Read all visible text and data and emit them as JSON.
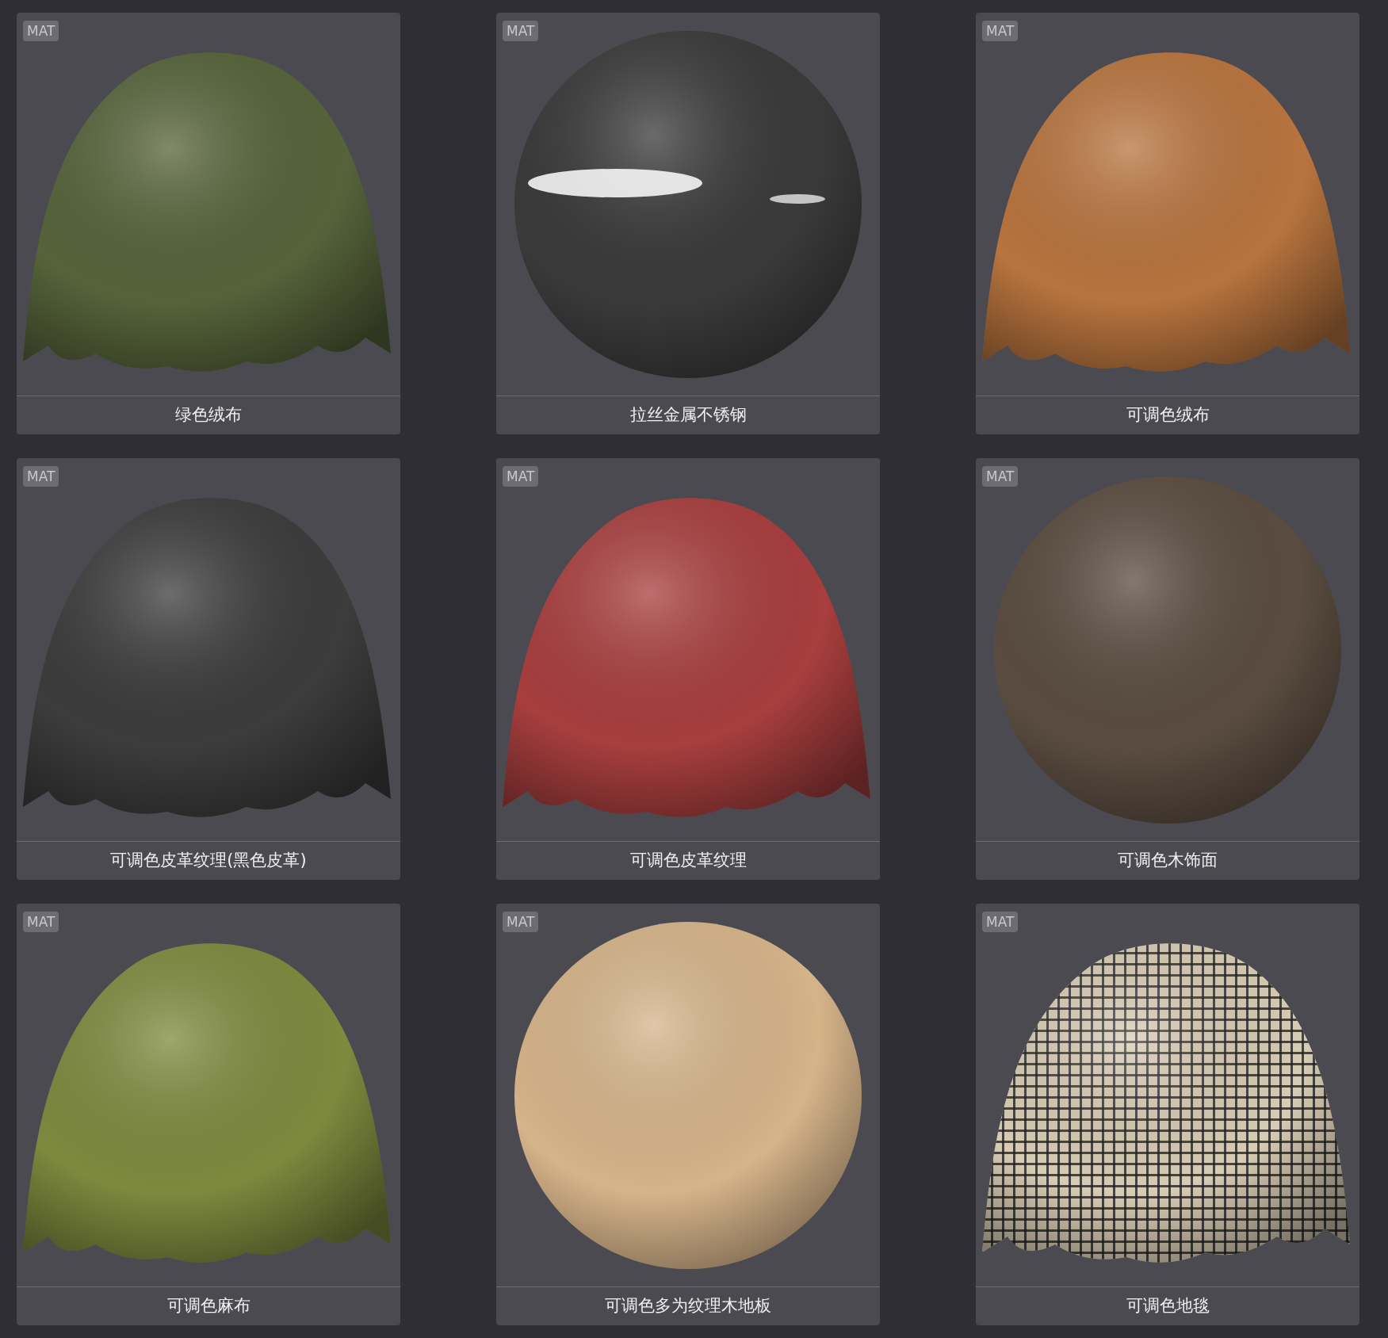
{
  "cards": [
    {
      "badge": "MAT",
      "label": "绿色绒布",
      "kind": "cloth",
      "color": "#56633a"
    },
    {
      "badge": "MAT",
      "label": "拉丝金属不锈钢",
      "kind": "metal",
      "color": "#3a3a3a"
    },
    {
      "badge": "MAT",
      "label": "可调色绒布",
      "kind": "cloth",
      "color": "#b8743e"
    },
    {
      "badge": "MAT",
      "label": "可调色皮革纹理(黑色皮革)",
      "kind": "cloth",
      "color": "#3c3c3c"
    },
    {
      "badge": "MAT",
      "label": "可调色皮革纹理",
      "kind": "cloth",
      "color": "#a83e3e"
    },
    {
      "badge": "MAT",
      "label": "可调色木饰面",
      "kind": "sphere",
      "color": "#5a4c40"
    },
    {
      "badge": "MAT",
      "label": "可调色麻布",
      "kind": "cloth",
      "color": "#7d8a3e"
    },
    {
      "badge": "MAT",
      "label": "可调色多为纹理木地板",
      "kind": "sphere",
      "color": "#d6b48a"
    },
    {
      "badge": "MAT",
      "label": "可调色地毯",
      "kind": "plaid",
      "color": "#d8ccb4"
    }
  ]
}
